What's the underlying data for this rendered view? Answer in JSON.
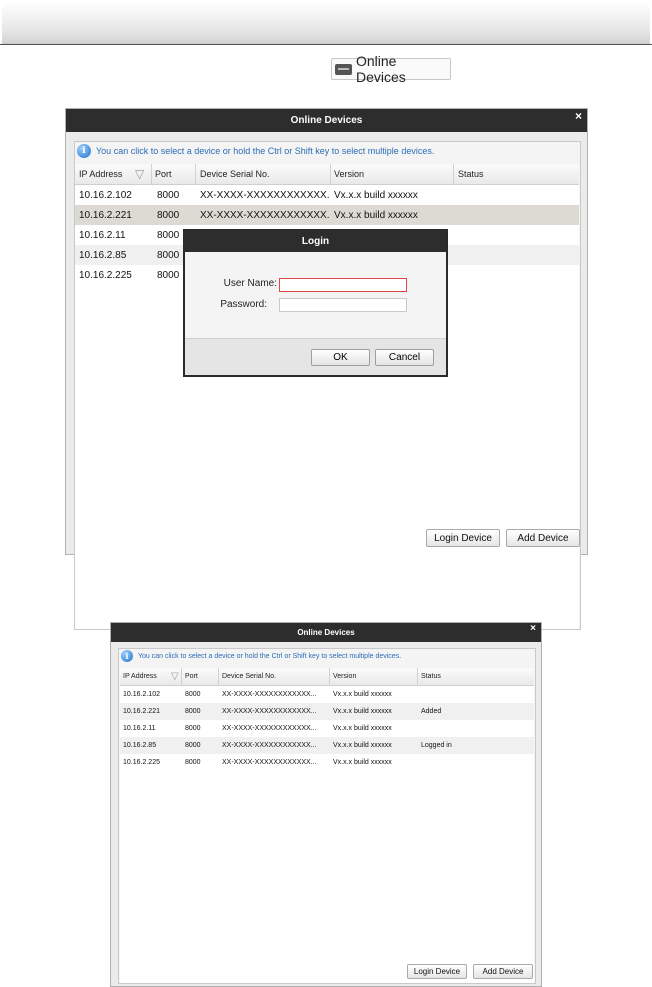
{
  "toolbar": {
    "online_devices_label": "Online Devices"
  },
  "dialog1": {
    "title": "Online Devices",
    "close": "×",
    "info": "You can click to select a device or hold the Ctrl or Shift key to select multiple devices.",
    "columns": [
      "IP Address",
      "Port",
      "Device Serial No.",
      "Version",
      "Status"
    ],
    "rows": [
      {
        "ip": "10.16.2.102",
        "port": "8000",
        "serial": "XX-XXXX-XXXXXXXXXXXX...",
        "version": "Vx.x.x build xxxxxx",
        "status": ""
      },
      {
        "ip": "10.16.2.221",
        "port": "8000",
        "serial": "XX-XXXX-XXXXXXXXXXXX...",
        "version": "Vx.x.x build xxxxxx",
        "status": ""
      },
      {
        "ip": "10.16.2.11",
        "port": "8000",
        "serial": "",
        "version": "",
        "status": ""
      },
      {
        "ip": "10.16.2.85",
        "port": "8000",
        "serial": "",
        "version": "",
        "status": ""
      },
      {
        "ip": "10.16.2.225",
        "port": "8000",
        "serial": "",
        "version": "",
        "status": ""
      }
    ],
    "login_device": "Login Device",
    "add_device": "Add Device"
  },
  "login": {
    "title": "Login",
    "username_label": "User Name:",
    "password_label": "Password:",
    "username_value": "",
    "password_value": "",
    "ok": "OK",
    "cancel": "Cancel"
  },
  "dialog2": {
    "title": "Online Devices",
    "close": "×",
    "info": "You can click to select a device or hold the Ctrl or Shift key to select multiple devices.",
    "columns": [
      "IP Address",
      "Port",
      "Device Serial No.",
      "Version",
      "Status"
    ],
    "rows": [
      {
        "ip": "10.16.2.102",
        "port": "8000",
        "serial": "XX-XXXX-XXXXXXXXXXXX...",
        "version": "Vx.x.x build xxxxxx",
        "status": ""
      },
      {
        "ip": "10.16.2.221",
        "port": "8000",
        "serial": "XX-XXXX-XXXXXXXXXXXX...",
        "version": "Vx.x.x build xxxxxx",
        "status": "Added"
      },
      {
        "ip": "10.16.2.11",
        "port": "8000",
        "serial": "XX-XXXX-XXXXXXXXXXXX...",
        "version": "Vx.x.x build xxxxxx",
        "status": ""
      },
      {
        "ip": "10.16.2.85",
        "port": "8000",
        "serial": "XX-XXXX-XXXXXXXXXXXX...",
        "version": "Vx.x.x build xxxxxx",
        "status": "Logged in"
      },
      {
        "ip": "10.16.2.225",
        "port": "8000",
        "serial": "XX-XXXX-XXXXXXXXXXXX...",
        "version": "Vx.x.x build xxxxxx",
        "status": ""
      }
    ],
    "login_device": "Login Device",
    "add_device": "Add Device"
  },
  "colors": {
    "titlebar": "#2d2d2d",
    "info_text": "#2a6db5",
    "selected_row": "#ddd9d3",
    "alt_row": "#f0f0f0",
    "focus_border": "#e04848"
  }
}
